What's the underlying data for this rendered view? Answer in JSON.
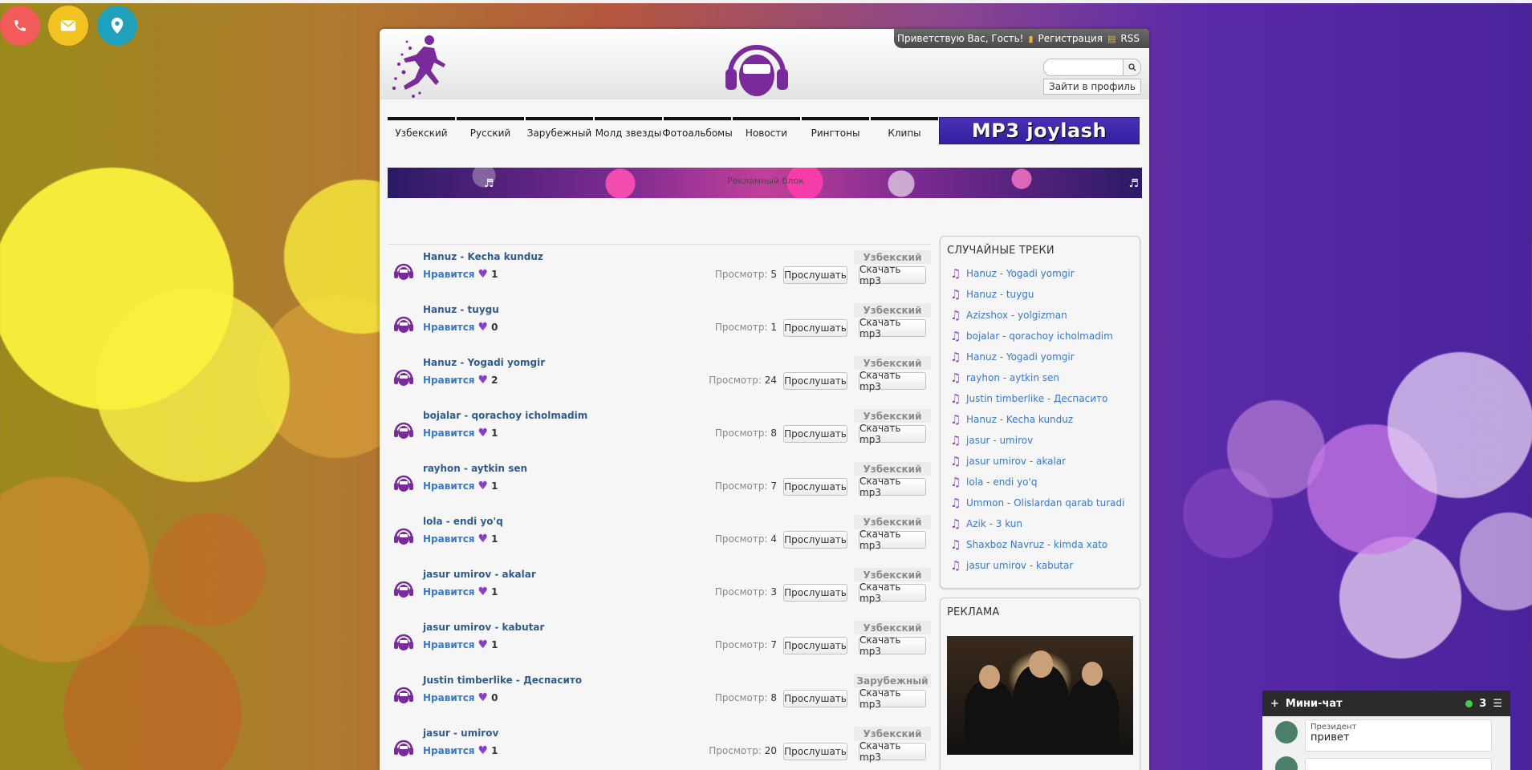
{
  "contacts": {
    "phone_icon": "phone-icon",
    "mail_icon": "envelope-icon",
    "location_icon": "map-pin-icon"
  },
  "header": {
    "greeting": "Приветствую Вас, Гость!",
    "register": "Регистрация",
    "rss": "RSS",
    "login": "Зайти в профиль",
    "search_placeholder": ""
  },
  "nav": {
    "items": [
      "Узбекский",
      "Русский",
      "Зарубежный",
      "Молд звезды",
      "Фотоальбомы",
      "Новости",
      "Рингтоны",
      "Клипы"
    ],
    "banner": "MP3 joylash"
  },
  "ad_banner": {
    "label": "Рекламный блок"
  },
  "tracks": [
    {
      "title": "Hanuz - Kecha kunduz",
      "like_label": "Нравится",
      "likes": "1",
      "category": "Узбекский",
      "views_label": "Просмотр:",
      "views": "5"
    },
    {
      "title": "Hanuz - tuygu",
      "like_label": "Нравится",
      "likes": "0",
      "category": "Узбекский",
      "views_label": "Просмотр:",
      "views": "1"
    },
    {
      "title": "Hanuz - Yogadi yomgir",
      "like_label": "Нравится",
      "likes": "2",
      "category": "Узбекский",
      "views_label": "Просмотр:",
      "views": "24"
    },
    {
      "title": "bojalar - qorachoy icholmadim",
      "like_label": "Нравится",
      "likes": "1",
      "category": "Узбекский",
      "views_label": "Просмотр:",
      "views": "8"
    },
    {
      "title": "rayhon - aytkin sen",
      "like_label": "Нравится",
      "likes": "1",
      "category": "Узбекский",
      "views_label": "Просмотр:",
      "views": "7"
    },
    {
      "title": "lola - endi yo'q",
      "like_label": "Нравится",
      "likes": "1",
      "category": "Узбекский",
      "views_label": "Просмотр:",
      "views": "4"
    },
    {
      "title": "jasur umirov - akalar",
      "like_label": "Нравится",
      "likes": "1",
      "category": "Узбекский",
      "views_label": "Просмотр:",
      "views": "3"
    },
    {
      "title": "jasur umirov - kabutar",
      "like_label": "Нравится",
      "likes": "1",
      "category": "Узбекский",
      "views_label": "Просмотр:",
      "views": "7"
    },
    {
      "title": "Justin timberlike - Деспасито",
      "like_label": "Нравится",
      "likes": "0",
      "category": "Зарубежный",
      "views_label": "Просмотр:",
      "views": "8"
    },
    {
      "title": "jasur - umirov",
      "like_label": "Нравится",
      "likes": "1",
      "category": "Узбекский",
      "views_label": "Просмотр:",
      "views": "20"
    }
  ],
  "buttons": {
    "listen": "Прослушать",
    "download": "Скачать mp3"
  },
  "random_tracks": {
    "title": "СЛУЧАЙНЫЕ ТРЕКИ",
    "items": [
      "Hanuz - Yogadi yomgir",
      "Hanuz - tuygu",
      "Azizshox - yolgizman",
      "bojalar - qorachoy icholmadim",
      "Hanuz - Yogadi yomgir",
      "rayhon - aytkin sen",
      "Justin timberlike - Деспасито",
      "Hanuz - Kecha kunduz",
      "jasur - umirov",
      "jasur umirov - akalar",
      "lola - endi yo'q",
      "Ummon - Olislardan qarab turadi",
      "Azik - 3 kun",
      "Shaxboz Navruz - kimda xato",
      "jasur umirov - kabutar"
    ]
  },
  "ad_box": {
    "title": "РЕКЛАМА"
  },
  "minichat": {
    "title": "Мини-чат",
    "online": "3",
    "messages": [
      {
        "name": "Президент",
        "text": "привет"
      }
    ]
  },
  "colors": {
    "accent": "#8a3fc2",
    "link": "#3a78c8",
    "title": "#2f5c8f"
  }
}
